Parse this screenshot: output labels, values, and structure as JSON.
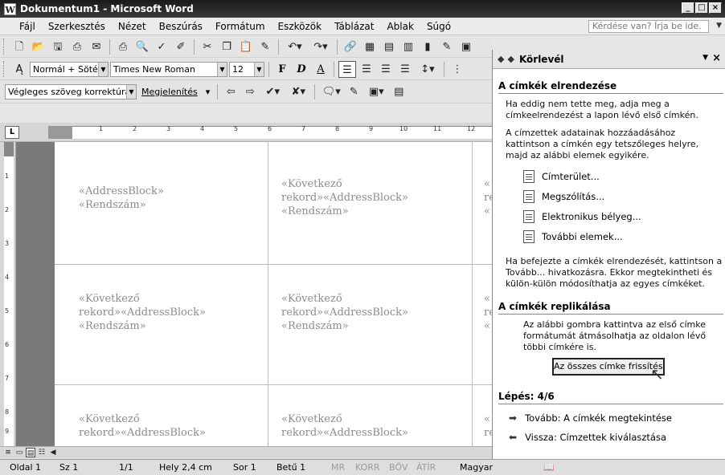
{
  "window": {
    "title": "Dokumentum1 - Microsoft Word",
    "min": "_",
    "max": "□",
    "close": "×"
  },
  "menu": {
    "items": [
      "Fájl",
      "Szerkesztés",
      "Nézet",
      "Beszúrás",
      "Formátum",
      "Eszközök",
      "Táblázat",
      "Ablak",
      "Súgó"
    ],
    "help_placeholder": "Kérdése van? Írja be ide."
  },
  "toolbar_fmt": {
    "style": "Normál + Sötét:",
    "font": "Times New Roman",
    "size": "12",
    "bold": "F",
    "italic": "D",
    "underline": "A"
  },
  "toolbar_review": {
    "mode": "Végleges szöveg korrektúrával",
    "show": "Megjelenítés"
  },
  "ruler": {
    "tab_marker": "L",
    "h_ticks": [
      "1",
      "2",
      "3",
      "4",
      "5",
      "6",
      "7",
      "8",
      "9",
      "10",
      "11",
      "12"
    ],
    "v_ticks": [
      "1",
      "2",
      "3",
      "4",
      "5",
      "6",
      "7",
      "8",
      "9"
    ]
  },
  "document": {
    "cells": [
      {
        "l1": "«AddressBlock»",
        "l2": "«Rendszám»",
        "l3": ""
      },
      {
        "l1": "«Következő",
        "l2": "rekord»«AddressBlock»",
        "l3": "«Rendszám»"
      },
      {
        "l1": "«",
        "l2": "re",
        "l3": "«"
      },
      {
        "l1": "«Következő",
        "l2": "rekord»«AddressBlock»",
        "l3": "«Rendszám»"
      },
      {
        "l1": "«Következő",
        "l2": "rekord»«AddressBlock»",
        "l3": "«Rendszám»"
      },
      {
        "l1": "«",
        "l2": "re",
        "l3": "«"
      },
      {
        "l1": "«Következő",
        "l2": "rekord»«AddressBlock»",
        "l3": ""
      },
      {
        "l1": "«Következő",
        "l2": "rekord»«AddressBlock»",
        "l3": ""
      },
      {
        "l1": "«",
        "l2": "re",
        "l3": ""
      }
    ]
  },
  "statusbar": {
    "page": "Oldal 1",
    "section": "Sz 1",
    "pages": "1/1",
    "position": "Hely 2,4 cm",
    "row": "Sor 1",
    "col": "Betű 1",
    "mr": "MR",
    "korr": "KORR",
    "bov": "BŐV",
    "atir": "ÁTÍR",
    "lang": "Magyar"
  },
  "pane": {
    "title": "Körlevél",
    "section1_title": "A címkék elrendezése",
    "p1": "Ha eddig nem tette meg, adja meg a címkeelrendezést a lapon lévő első címkén.",
    "p2": "A címzettek adatainak hozzáadásához kattintson a címkén egy tetszőleges helyre, majd az alábbi elemek egyikére.",
    "links": [
      "Címterület...",
      "Megszólítás...",
      "Elektronikus bélyeg...",
      "További elemek..."
    ],
    "p3": "Ha befejezte a címkék elrendezését, kattintson a Tovább... hivatkozásra. Ekkor megtekintheti és külön-külön módosíthatja az egyes címkéket.",
    "section2_title": "A címkék replikálása",
    "p4": "Az alábbi gombra kattintva az első címke formátumát átmásolhatja az oldalon lévő többi címkére is.",
    "button": "Az összes címke frissítése",
    "step": "Lépés: 4/6",
    "next": "Tovább: A címkék megtekintése",
    "back": "Vissza: Címzettek kiválasztása"
  }
}
